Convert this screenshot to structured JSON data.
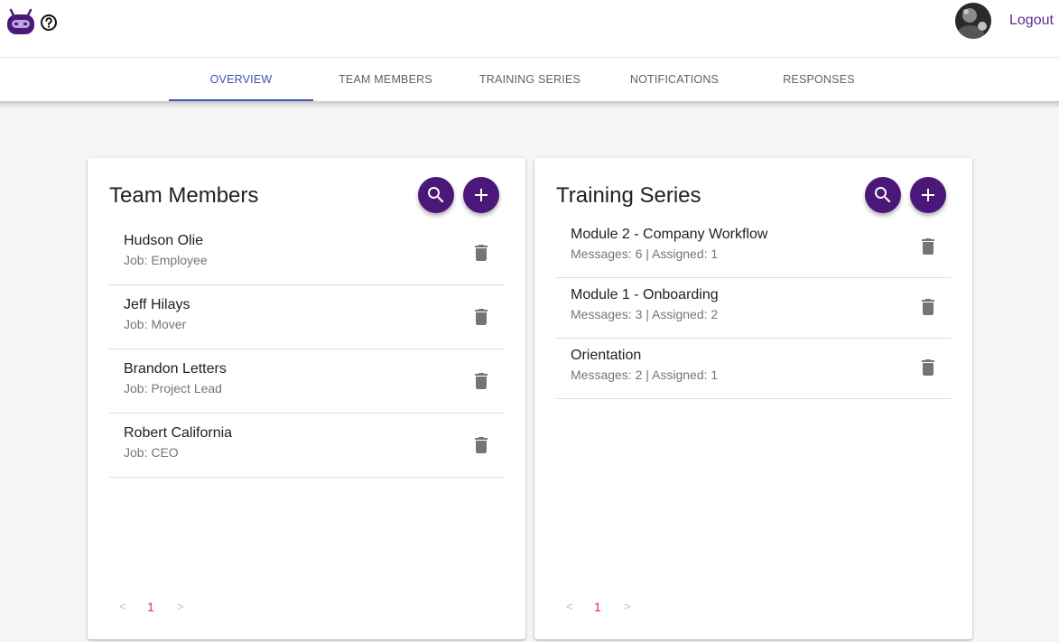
{
  "header": {
    "logout_label": "Logout"
  },
  "tabs": [
    {
      "label": "OVERVIEW",
      "active": true
    },
    {
      "label": "TEAM MEMBERS"
    },
    {
      "label": "TRAINING SERIES"
    },
    {
      "label": "NOTIFICATIONS"
    },
    {
      "label": "RESPONSES"
    }
  ],
  "team_members": {
    "title": "Team Members",
    "items": [
      {
        "name": "Hudson Olie",
        "job": "Job: Employee"
      },
      {
        "name": "Jeff Hilays",
        "job": "Job: Mover"
      },
      {
        "name": "Brandon Letters",
        "job": "Job: Project Lead"
      },
      {
        "name": "Robert California",
        "job": "Job: CEO"
      }
    ],
    "pager": {
      "prev": "<",
      "page": "1",
      "next": ">"
    }
  },
  "training_series": {
    "title": "Training Series",
    "items": [
      {
        "name": "Module 2 - Company Workflow",
        "meta": "Messages: 6 | Assigned: 1"
      },
      {
        "name": "Module 1 - Onboarding",
        "meta": "Messages: 3 | Assigned: 2"
      },
      {
        "name": "Orientation",
        "meta": "Messages: 2 | Assigned: 1"
      }
    ],
    "pager": {
      "prev": "<",
      "page": "1",
      "next": ">"
    }
  },
  "colors": {
    "accent": "#3f51b5",
    "fab": "#4a1878",
    "brand": "#5b2d96",
    "page_number": "#e91e63"
  },
  "icons": [
    "robot-logo-icon",
    "help-icon",
    "search-icon",
    "add-icon",
    "trash-icon"
  ]
}
